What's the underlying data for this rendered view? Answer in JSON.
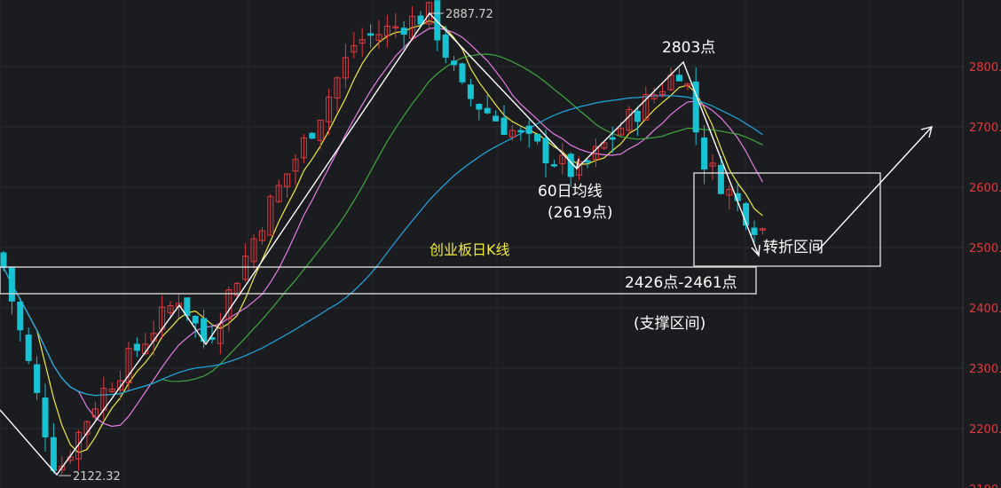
{
  "chart_data": {
    "type": "candlestick",
    "title": "创业板日K线",
    "y_axis": {
      "position": "right",
      "ticks": [
        2800,
        2700,
        2600,
        2500,
        2400,
        2300,
        2200,
        2100
      ],
      "tick_labels": [
        "2800.",
        "2700.",
        "2600.",
        "2500.",
        "2400.",
        "2300.",
        "2200.",
        "2100."
      ],
      "range": [
        2100,
        2900
      ]
    },
    "x_axis": {
      "bars": 92
    },
    "grid": true,
    "legend": "none",
    "colors": {
      "up": "#e0393e",
      "down": "#17c3d3",
      "ma_yellow": "#f0ea3a",
      "ma_pink": "#e87be8",
      "ma_green": "#3caa3c",
      "ma_blue": "#1ea9e6",
      "annotation": "#ffffff"
    },
    "extremes": [
      {
        "label": "2887.72",
        "value": 2887.72
      },
      {
        "label": "2122.32",
        "value": 2122.32
      }
    ],
    "annotations": [
      {
        "id": "peak2",
        "text": "2803点",
        "value": 2803
      },
      {
        "id": "ma60",
        "text": "60日均线"
      },
      {
        "id": "ma60_val",
        "text": "(2619点)",
        "value": 2619
      },
      {
        "id": "turn",
        "text": "转折区间"
      },
      {
        "id": "support",
        "text": "2426点-2461点"
      },
      {
        "id": "support_label",
        "text": "(支撑区间)"
      }
    ],
    "support_zone": [
      2426,
      2461
    ],
    "turn_zone": [
      2462,
      2625
    ]
  }
}
